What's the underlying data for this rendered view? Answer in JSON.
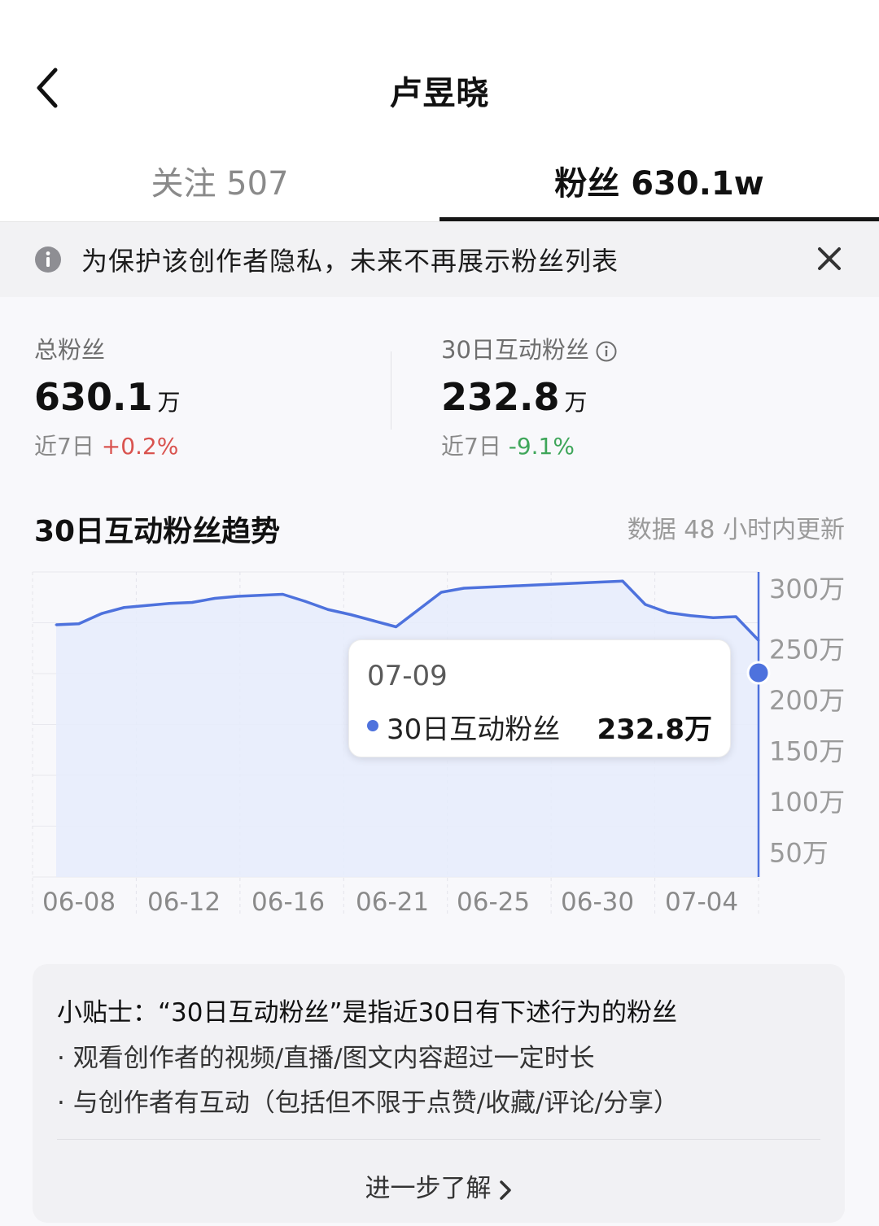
{
  "header": {
    "title": "卢昱晓"
  },
  "tabs": [
    {
      "label": "关注 507",
      "active": false
    },
    {
      "label": "粉丝 630.1w",
      "active": true
    }
  ],
  "notice": {
    "text": "为保护该创作者隐私，未来不再展示粉丝列表"
  },
  "stats": {
    "total": {
      "label": "总粉丝",
      "value": "630.1",
      "unit": "万",
      "period": "近7日",
      "change": "+0.2%"
    },
    "active": {
      "label": "30日互动粉丝",
      "value": "232.8",
      "unit": "万",
      "period": "近7日",
      "change": "-9.1%"
    }
  },
  "trend": {
    "title": "30日互动粉丝趋势",
    "note": "数据 48 小时内更新"
  },
  "tooltip": {
    "date": "07-09",
    "series": "30日互动粉丝",
    "value": "232.8万"
  },
  "tips": {
    "title": "小贴士：“30日互动粉丝”是指近30日有下述行为的粉丝",
    "items": [
      "· 观看创作者的视频/直播/图文内容超过一定时长",
      "· 与创作者有互动（包括但不限于点赞/收藏/评论/分享）"
    ],
    "link": "进一步了解"
  },
  "colors": {
    "line": "#4e72dd",
    "area": "#e6ecfb",
    "up": "#d9534f",
    "down": "#3fa65a"
  },
  "chart_data": {
    "type": "area",
    "series": [
      {
        "name": "30日互动粉丝",
        "x": [
          "06-08",
          "06-09",
          "06-10",
          "06-11",
          "06-12",
          "06-13",
          "06-14",
          "06-15",
          "06-16",
          "06-17",
          "06-18",
          "06-19",
          "06-20",
          "06-21",
          "06-22",
          "06-23",
          "06-24",
          "06-25",
          "06-26",
          "06-27",
          "06-28",
          "06-29",
          "06-30",
          "07-01",
          "07-02",
          "07-03",
          "07-04",
          "07-05",
          "07-06",
          "07-07",
          "07-08",
          "07-09"
        ],
        "values": [
          248,
          249,
          259,
          265,
          267,
          269,
          270,
          274,
          276,
          277,
          278,
          271,
          263,
          258,
          252,
          246,
          263,
          280,
          284,
          285,
          286,
          287,
          288,
          289,
          290,
          291,
          268,
          260,
          257,
          255,
          256,
          232.8
        ]
      }
    ],
    "x_tick_labels": [
      "06-08",
      "06-12",
      "06-16",
      "06-21",
      "06-25",
      "06-30",
      "07-04"
    ],
    "y_tick_labels": [
      "300万",
      "250万",
      "200万",
      "150万",
      "100万",
      "50万"
    ],
    "ylim": [
      0,
      300
    ],
    "y_axis_side": "right",
    "grid": true,
    "highlight": {
      "x": "07-09",
      "value": 232.8
    },
    "title": "30日互动粉丝趋势"
  }
}
